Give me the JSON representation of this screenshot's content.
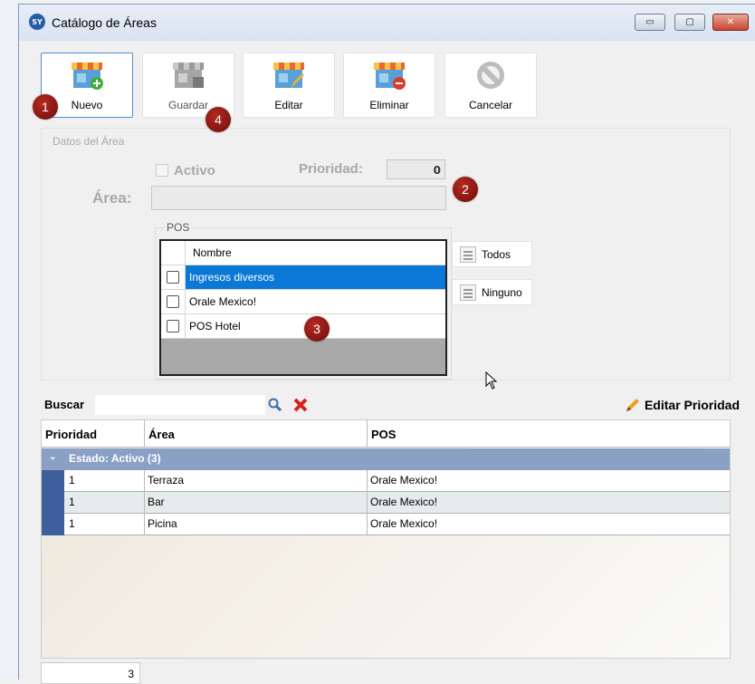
{
  "window": {
    "title": "Catálogo de Áreas",
    "app_icon": "SY",
    "buttons": {
      "minimize": "▭",
      "maximize": "▢",
      "close": "✕"
    }
  },
  "toolbar": {
    "nuevo": "Nuevo",
    "guardar": "Guardar",
    "editar": "Editar",
    "eliminar": "Eliminar",
    "cancelar": "Cancelar"
  },
  "badges": {
    "b1": "1",
    "b2": "2",
    "b3": "3",
    "b4": "4"
  },
  "details": {
    "group_title": "Datos del Área",
    "activo_label": "Activo",
    "prioridad_label": "Prioridad:",
    "prioridad_value": "0",
    "area_label": "Área:",
    "area_value": ""
  },
  "pos": {
    "title": "POS",
    "header": "Nombre",
    "items": [
      {
        "name": "Ingresos diversos"
      },
      {
        "name": "Orale Mexico!"
      },
      {
        "name": "POS Hotel"
      }
    ],
    "todos": "Todos",
    "ninguno": "Ninguno"
  },
  "search": {
    "label": "Buscar",
    "value": "",
    "edit_priority": "Editar Prioridad"
  },
  "grid": {
    "columns": [
      "Prioridad",
      "Área",
      "POS"
    ],
    "group_label": "Estado: Activo (3)",
    "rows": [
      {
        "prioridad": "1",
        "area": "Terraza",
        "pos": "Orale Mexico!"
      },
      {
        "prioridad": "1",
        "area": "Bar",
        "pos": "Orale Mexico!"
      },
      {
        "prioridad": "1",
        "area": "Picina",
        "pos": "Orale Mexico!"
      }
    ],
    "count": "3"
  },
  "colors": {
    "accent": "#0a78d7",
    "group_row": "#8aa0c4",
    "badge": "#8b1a12"
  }
}
